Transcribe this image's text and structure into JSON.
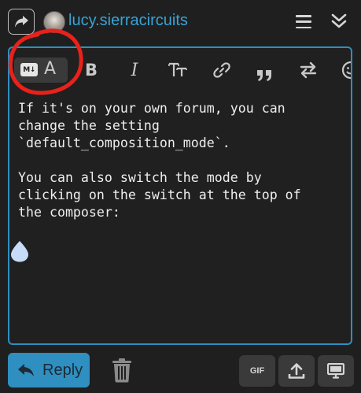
{
  "header": {
    "username": "lucy.sierracircuits",
    "icons": {
      "reply_mode": "share-arrow-icon",
      "menu": "hamburger-icon",
      "collapse": "double-chevron-down-icon"
    }
  },
  "toolbar": {
    "markdown_icon_text": "M↓",
    "rich_text_glyph": "A",
    "bold_glyph": "B",
    "italic_glyph": "I",
    "heading_glyph": "TT",
    "quote_glyph": "”",
    "icons": [
      "markdown-icon",
      "rich-text-icon",
      "bold-icon",
      "italic-icon",
      "heading-icon",
      "link-icon",
      "quote-icon",
      "switch-icon",
      "emoji-icon"
    ]
  },
  "editor": {
    "text": "If it's on your own forum, you can\nchange the setting\n`default_composition_mode`.\n\nYou can also switch the mode by\nclicking on the switch at the top of\nthe composer:"
  },
  "footer": {
    "reply_label": "Reply",
    "gif_label": "GIF",
    "icons": [
      "reply-arrow-icon",
      "trash-icon",
      "gif-icon",
      "upload-icon",
      "desktop-preview-icon"
    ]
  },
  "colors": {
    "background": "#1f1f1f",
    "accent": "#2f8fc0",
    "username": "#3aa3d6",
    "annotation": "#e8221b",
    "button_bg": "#3a3a3a"
  }
}
